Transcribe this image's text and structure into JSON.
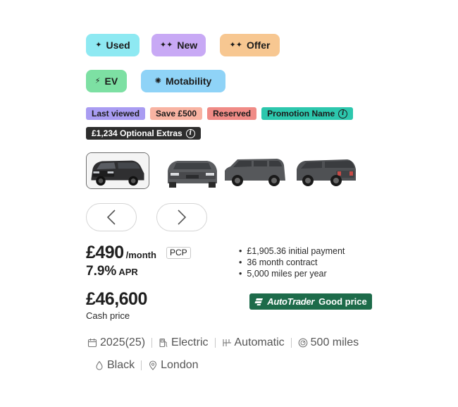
{
  "primary_badges": [
    {
      "label": "Used",
      "icon": "sparkle-icon",
      "icon_glyph": "✦",
      "color": "#8ee9f2"
    },
    {
      "label": "New",
      "icon": "sparkles-icon",
      "icon_glyph": "✦✦",
      "color": "#c8a9f5"
    },
    {
      "label": "Offer",
      "icon": "sparkles-icon",
      "icon_glyph": "✦✦",
      "color": "#f7c791"
    }
  ],
  "secondary_badges": [
    {
      "label": "EV",
      "icon": "lightning-icon",
      "icon_glyph": "⚡",
      "color": "#7de0a3"
    },
    {
      "label": "Motability",
      "icon": "motability-icon",
      "icon_glyph": "✺",
      "color": "#8fd3f7"
    }
  ],
  "tags": {
    "last_viewed": "Last viewed",
    "save": "Save £500",
    "reserved": "Reserved",
    "promotion": "Promotion Name",
    "extras": "£1,234 Optional Extras"
  },
  "gallery": {
    "thumbnails": [
      "car-front-three-quarter",
      "car-front",
      "car-side",
      "car-rear-three-quarter"
    ],
    "active_index": 0
  },
  "finance": {
    "monthly": "£490",
    "per_month": "/month",
    "type": "PCP",
    "apr_value": "7.9%",
    "apr_label": "APR",
    "details": [
      "£1,905.36 initial payment",
      "36 month contract",
      "5,000 miles per year"
    ]
  },
  "cash": {
    "price": "£46,600",
    "label": "Cash price"
  },
  "price_indicator": {
    "brand": "AutoTrader",
    "rating": "Good price",
    "color": "#1d6b4a"
  },
  "specs_row1": [
    {
      "icon": "calendar-icon",
      "value": "2025(25)"
    },
    {
      "icon": "fuel-pump-icon",
      "value": "Electric"
    },
    {
      "icon": "gearbox-icon",
      "value": "Automatic"
    },
    {
      "icon": "odometer-icon",
      "value": "500 miles"
    }
  ],
  "specs_row2": [
    {
      "icon": "paint-drop-icon",
      "value": "Black"
    },
    {
      "icon": "location-pin-icon",
      "value": "London"
    }
  ]
}
